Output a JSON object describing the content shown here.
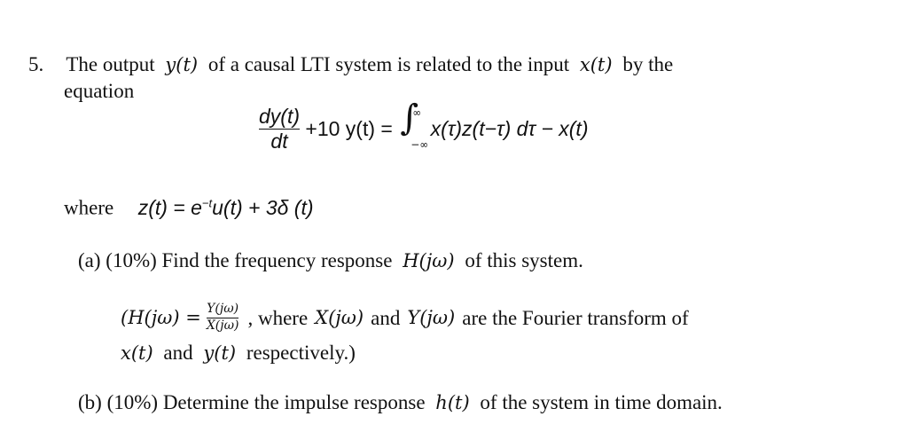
{
  "problem": {
    "number": "5.",
    "intro_line1_a": "The output",
    "intro_y": "y(t)",
    "intro_line1_b": "of a causal LTI system is related to the input",
    "intro_x": "x(t)",
    "intro_line1_c": "by the",
    "intro_line2": "equation",
    "equation": {
      "deriv_num": "dy(t)",
      "deriv_den": "dt",
      "lhs_rest": "+10 y(t) =",
      "integral_upper": "∞",
      "integral_lower": "−∞",
      "integrand": "x(τ)z(t−τ) dτ − x(t)"
    },
    "where_label": "where",
    "z_def_a": "z(t) = e",
    "z_def_exp": "−t",
    "z_def_b": "u(t) + 3δ (t)"
  },
  "part_a": {
    "label": "(a)",
    "weight": "(10%)",
    "text_a": "Find the frequency response",
    "H": "H(jω)",
    "text_b": "of this system.",
    "note_open": "(H(jω) =",
    "note_frac_num": "Y(jω)",
    "note_frac_den": "X(jω)",
    "note_mid": ", where",
    "note_X": "X(jω)",
    "note_and": "and",
    "note_Y": "Y(jω)",
    "note_tail": "are the Fourier transform of",
    "note_line2_x": "x(t)",
    "note_line2_and": "and",
    "note_line2_y": "y(t)",
    "note_line2_end": "respectively.)"
  },
  "part_b": {
    "label": "(b)",
    "weight": "(10%)",
    "text_a": "Determine the impulse response",
    "h": "h(t)",
    "text_b": "of the system in time domain."
  }
}
